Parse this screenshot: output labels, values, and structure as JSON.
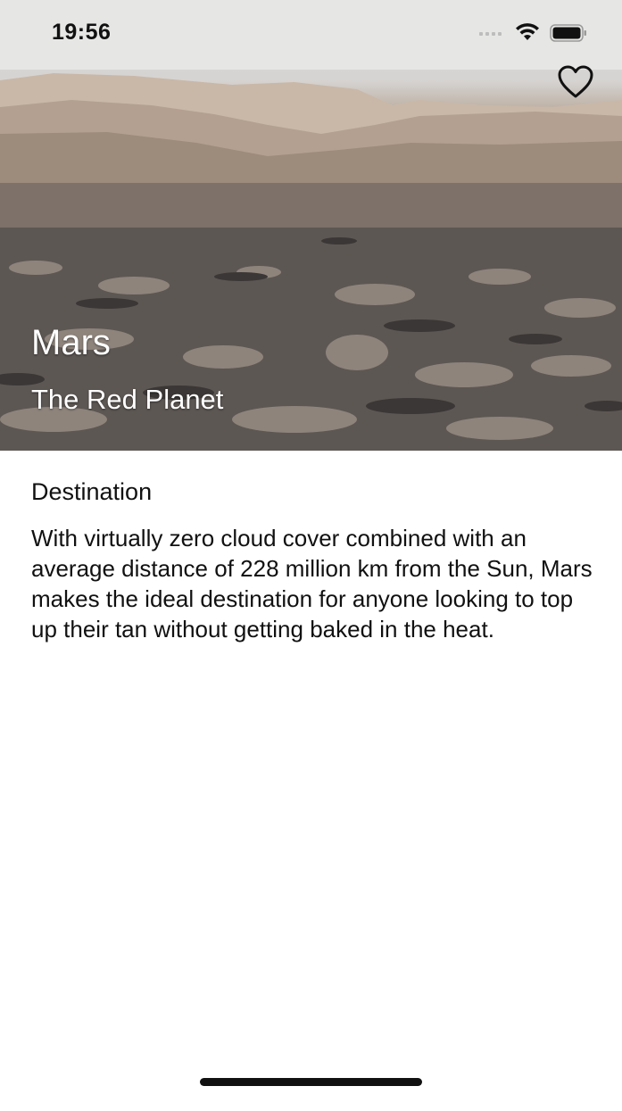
{
  "status_bar": {
    "time": "19:56"
  },
  "hero": {
    "image_subject": "mars-rocky-landscape",
    "title": "Mars",
    "subtitle": "The Red Planet",
    "favorite_icon": "heart-outline-icon"
  },
  "content": {
    "heading": "Destination",
    "description": "With virtually zero cloud cover combined with an average distance of 228 million km from the Sun, Mars makes the ideal destination for anyone looking to top up their tan without getting baked in the heat."
  },
  "colors": {
    "text": "#111111",
    "hero_text": "#ffffff",
    "background": "#ffffff"
  }
}
